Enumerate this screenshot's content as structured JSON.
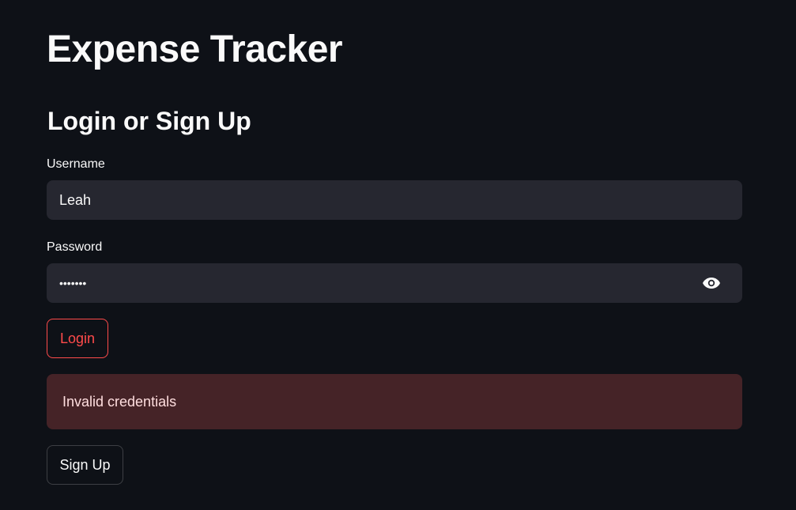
{
  "app": {
    "title": "Expense Tracker"
  },
  "section": {
    "title": "Login or Sign Up"
  },
  "form": {
    "username": {
      "label": "Username",
      "value": "Leah"
    },
    "password": {
      "label": "Password",
      "value": "•••••••",
      "toggle_icon": "eye-icon"
    },
    "login_label": "Login",
    "signup_label": "Sign Up"
  },
  "alert": {
    "message": "Invalid credentials",
    "type": "error"
  },
  "colors": {
    "background": "#0e1117",
    "input_bg": "#262730",
    "primary": "#ff4b4b",
    "error_bg": "#452327",
    "error_text": "#ffdedf",
    "text": "#fafafa"
  }
}
